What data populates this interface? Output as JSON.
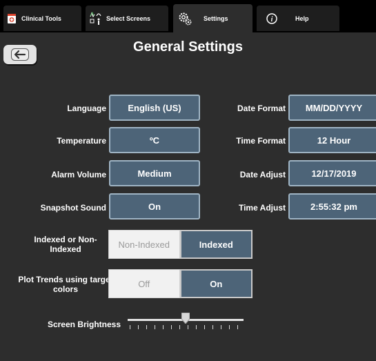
{
  "tabs": [
    {
      "label": "Clinical Tools",
      "icon": "clinical-tools-icon"
    },
    {
      "label": "Select Screens",
      "icon": "select-screens-icon"
    },
    {
      "label": "Settings",
      "icon": "gear-icon"
    },
    {
      "label": "Help",
      "icon": "info-icon"
    }
  ],
  "page": {
    "title": "General Settings"
  },
  "settings_left": [
    {
      "label": "Language",
      "value": "English (US)"
    },
    {
      "label": "Temperature",
      "value": "ºC"
    },
    {
      "label": "Alarm Volume",
      "value": "Medium"
    },
    {
      "label": "Snapshot Sound",
      "value": "On"
    }
  ],
  "settings_right": [
    {
      "label": "Date Format",
      "value": "MM/DD/YYYY"
    },
    {
      "label": "Time Format",
      "value": "12 Hour"
    },
    {
      "label": "Date Adjust",
      "value": "12/17/2019"
    },
    {
      "label": "Time Adjust",
      "value": "2:55:32 pm"
    }
  ],
  "indexed": {
    "label": "Indexed or Non-Indexed",
    "options": [
      "Non-Indexed",
      "Indexed"
    ],
    "selected": "Indexed"
  },
  "plot_trends": {
    "label": "Plot Trends using target colors",
    "options": [
      "Off",
      "On"
    ],
    "selected": "On"
  },
  "brightness": {
    "label": "Screen Brightness",
    "level": 0.5
  },
  "colors": {
    "value_button": "#4d6478",
    "active_tab": "#2d2d2d",
    "background": "#2d2d2d"
  }
}
